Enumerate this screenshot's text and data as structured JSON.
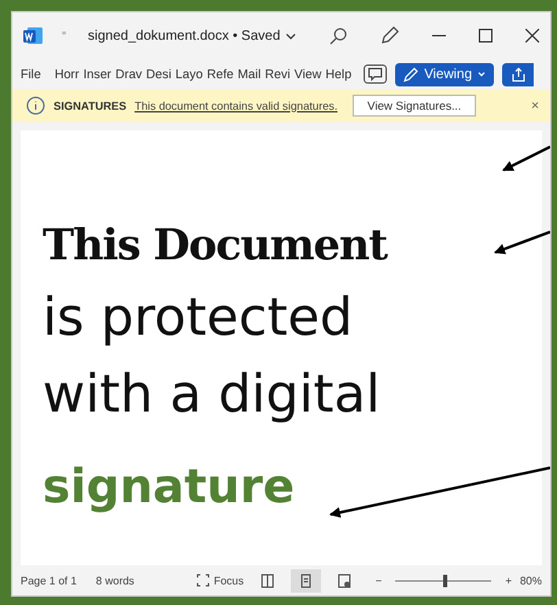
{
  "window": {
    "title": "signed_dokument.docx • Saved",
    "quick_access": "⁼"
  },
  "ribbon": {
    "tabs": [
      {
        "label": "File"
      },
      {
        "label": "Horr"
      },
      {
        "label": "Inser"
      },
      {
        "label": "Drav"
      },
      {
        "label": "Desi"
      },
      {
        "label": "Layo"
      },
      {
        "label": "Refe"
      },
      {
        "label": "Mail"
      },
      {
        "label": "Revi"
      },
      {
        "label": "View"
      },
      {
        "label": "Help"
      }
    ],
    "mode_button": "Viewing"
  },
  "message_bar": {
    "title": "SIGNATURES",
    "message": "This document contains valid signatures.",
    "button": "View Signatures...",
    "close": "×"
  },
  "document": {
    "lines": [
      {
        "kind": "heading",
        "text": "This Document"
      },
      {
        "kind": "body",
        "text": "is protected"
      },
      {
        "kind": "body",
        "text": "with a digital"
      },
      {
        "kind": "highlight",
        "text": "signature"
      }
    ]
  },
  "status_bar": {
    "page": "Page 1 of 1",
    "words": "8 words",
    "focus": "Focus",
    "views": [
      {
        "selected": false
      },
      {
        "selected": true
      },
      {
        "selected": false
      }
    ],
    "zoom_out": "−",
    "zoom_in": "+",
    "zoom": {
      "level": 0.5
    },
    "zoom_label": "80%"
  }
}
